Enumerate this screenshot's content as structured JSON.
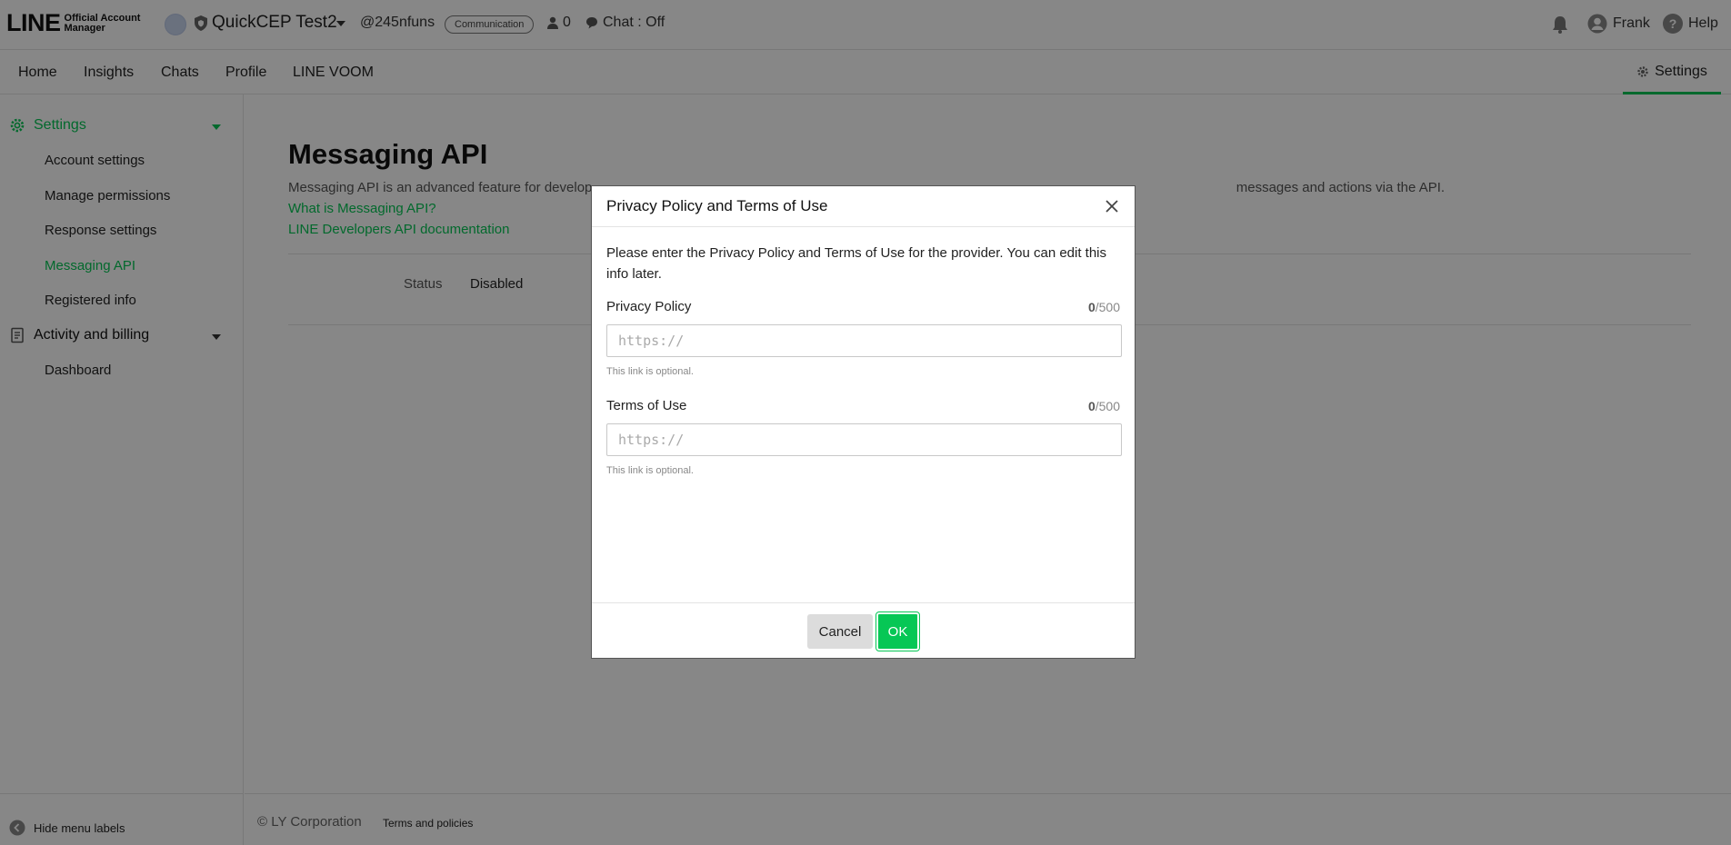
{
  "header": {
    "logo_main": "LINE",
    "logo_sub_1": "Official Account",
    "logo_sub_2": "Manager",
    "account_name": "QuickCEP Test2",
    "account_id": "@245nfuns",
    "plan_badge": "Communication",
    "friends_count": "0",
    "chat_status": "Chat : Off",
    "user_name": "Frank",
    "help_label": "Help"
  },
  "nav": {
    "items": [
      "Home",
      "Insights",
      "Chats",
      "Profile",
      "LINE VOOM"
    ],
    "settings_label": "Settings"
  },
  "sidebar": {
    "settings_section": "Settings",
    "settings_items": [
      "Account settings",
      "Manage permissions",
      "Response settings",
      "Messaging API",
      "Registered info"
    ],
    "active_item": "Messaging API",
    "billing_section": "Activity and billing",
    "billing_items": [
      "Dashboard"
    ],
    "hide_labels": "Hide menu labels"
  },
  "main": {
    "title": "Messaging API",
    "description": "Messaging API is an advanced feature for develop... with the API. ...messages and actions via the API.",
    "description_left": "Messaging API is an advanced feature for develop",
    "description_right": "messages and actions via the API.",
    "link_what": "What is Messaging API?",
    "link_docs": "LINE Developers API documentation",
    "status_label": "Status",
    "status_value": "Disabled",
    "copyright": "© LY Corporation",
    "terms": "Terms and policies"
  },
  "modal": {
    "title": "Privacy Policy and Terms of Use",
    "intro": "Please enter the Privacy Policy and Terms of Use for the provider. You can edit this info later.",
    "privacy": {
      "label": "Privacy Policy",
      "count": "0",
      "max": "/500",
      "placeholder": "https://",
      "value": "",
      "hint": "This link is optional."
    },
    "terms": {
      "label": "Terms of Use",
      "count": "0",
      "max": "/500",
      "placeholder": "https://",
      "value": "",
      "hint": "This link is optional."
    },
    "cancel_label": "Cancel",
    "ok_label": "OK"
  },
  "colors": {
    "brand_green": "#06c755",
    "overlay": "rgba(0,0,0,0.47)"
  },
  "icons": [
    "shield-icon",
    "caret-down-icon",
    "friends-icon",
    "chat-bubble-icon",
    "bell-icon",
    "user-avatar-icon",
    "help-icon",
    "gear-icon",
    "billing-icon",
    "collapse-icon",
    "close-icon"
  ]
}
